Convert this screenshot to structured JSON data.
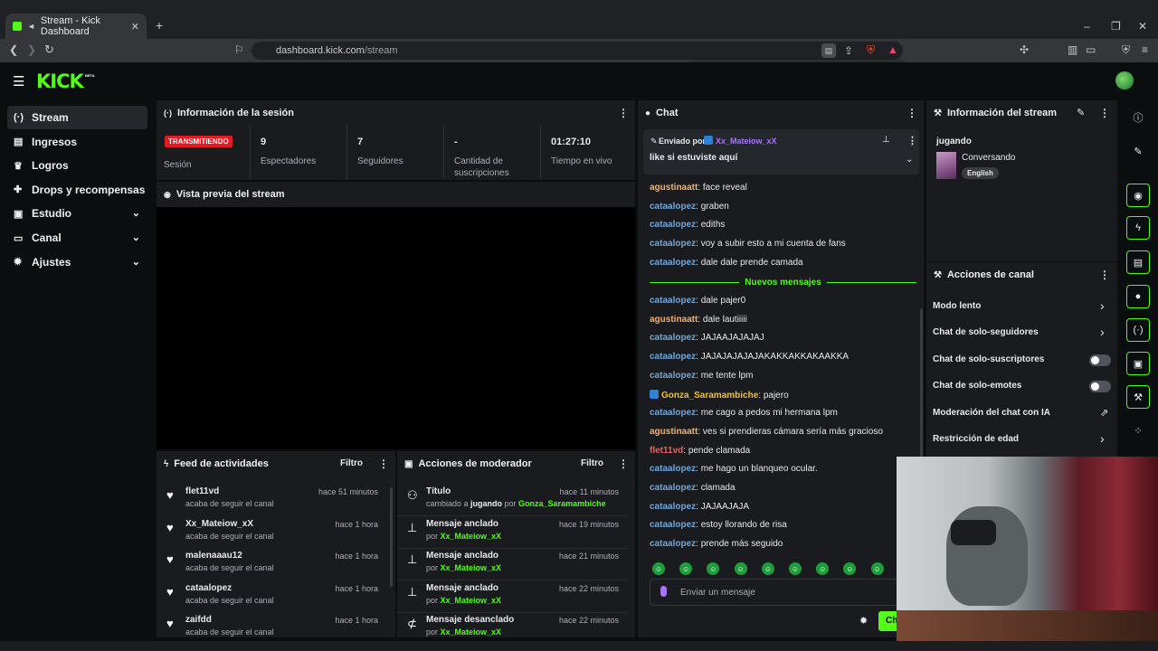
{
  "browser": {
    "tab_title": "Stream - Kick Dashboard",
    "url_host": "dashboard.kick.com",
    "url_path": "/stream",
    "new_tab_symbol": "+",
    "window_controls": [
      "–",
      "❐",
      "✕"
    ]
  },
  "brand": {
    "logo": "KICK",
    "beta": "BETA",
    "accent": "#53fc18"
  },
  "sidebar": {
    "items": [
      {
        "label": "Stream",
        "icon": "broadcast-icon",
        "glyph": "(·)",
        "active": true
      },
      {
        "label": "Ingresos",
        "icon": "wallet-icon",
        "glyph": "▤"
      },
      {
        "label": "Logros",
        "icon": "trophy-icon",
        "glyph": "♛"
      },
      {
        "label": "Drops y recompensas",
        "icon": "gift-icon",
        "glyph": "✚"
      },
      {
        "label": "Estudio",
        "icon": "studio-icon",
        "glyph": "▣",
        "expandable": true
      },
      {
        "label": "Canal",
        "icon": "channel-icon",
        "glyph": "▭",
        "expandable": true
      },
      {
        "label": "Ajustes",
        "icon": "gear-icon",
        "glyph": "✹",
        "expandable": true
      }
    ]
  },
  "session": {
    "title": "Información de la sesión",
    "badge": "TRANSMITIENDO",
    "badge_sub": "Sesión",
    "stats": [
      {
        "value": "9",
        "label": "Espectadores"
      },
      {
        "value": "7",
        "label": "Seguidores"
      },
      {
        "value": "-",
        "label": "Cantidad de suscripciones"
      },
      {
        "value": "01:27:10",
        "label": "Tiempo en vivo"
      }
    ]
  },
  "preview": {
    "title": "Vista previa del stream"
  },
  "feed": {
    "title": "Feed de actividades",
    "filter": "Filtro",
    "items": [
      {
        "name": "flet11vd",
        "action": "acaba de seguir el canal",
        "time": "hace 51 minutos"
      },
      {
        "name": "Xx_Mateiow_xX",
        "action": "acaba de seguir el canal",
        "time": "hace 1 hora"
      },
      {
        "name": "malenaaau12",
        "action": "acaba de seguir el canal",
        "time": "hace 1 hora"
      },
      {
        "name": "cataalopez",
        "action": "acaba de seguir el canal",
        "time": "hace 1 hora"
      },
      {
        "name": "zaifdd",
        "action": "acaba de seguir el canal",
        "time": "hace 1 hora"
      }
    ]
  },
  "mod": {
    "title": "Acciones de moderador",
    "filter": "Filtro",
    "items": [
      {
        "title": "Título",
        "line_pre": "cambiado a ",
        "line_bold": "jugando",
        "line_mid": " por ",
        "line_user": "Gonza_Saramambiche",
        "time": "hace 11 minutos",
        "icon": "title-icon"
      },
      {
        "title": "Mensaje anclado",
        "line_pre": "",
        "line_bold": "",
        "line_mid": "por ",
        "line_user": "Xx_Mateiow_xX",
        "time": "hace 19 minutos",
        "icon": "pin-icon"
      },
      {
        "title": "Mensaje anclado",
        "line_pre": "",
        "line_bold": "",
        "line_mid": "por ",
        "line_user": "Xx_Mateiow_xX",
        "time": "hace 21 minutos",
        "icon": "pin-icon"
      },
      {
        "title": "Mensaje anclado",
        "line_pre": "",
        "line_bold": "",
        "line_mid": "por ",
        "line_user": "Xx_Mateiow_xX",
        "time": "hace 22 minutos",
        "icon": "pin-icon"
      },
      {
        "title": "Mensaje desanclado",
        "line_pre": "",
        "line_bold": "",
        "line_mid": "por ",
        "line_user": "Xx_Mateiow_xX",
        "time": "hace 22 minutos",
        "icon": "unpin-icon"
      }
    ]
  },
  "chat": {
    "title": "Chat",
    "pinned_by_label": "Enviado por",
    "pinned_user": "Xx_Mateiow_xX",
    "pinned_text": "like si estuviste aquí",
    "new_messages": "Nuevos mensajes",
    "input_placeholder": "Enviar un mensaje",
    "send_label": "Ch",
    "messages_before": [
      {
        "user": "agustinaatt",
        "color": "#f6b26b",
        "text": "face reveal"
      },
      {
        "user": "cataalopez",
        "color": "#6fa8dc",
        "text": "graben"
      },
      {
        "user": "cataalopez",
        "color": "#6fa8dc",
        "text": "ediths"
      },
      {
        "user": "cataalopez",
        "color": "#6fa8dc",
        "text": "voy a subir esto a mi cuenta de fans"
      },
      {
        "user": "cataalopez",
        "color": "#6fa8dc",
        "text": "dale dale prende camada"
      }
    ],
    "messages_after": [
      {
        "user": "cataalopez",
        "color": "#6fa8dc",
        "text": "dale pajer0"
      },
      {
        "user": "agustinaatt",
        "color": "#f6b26b",
        "text": "dale lautiiiii"
      },
      {
        "user": "cataalopez",
        "color": "#6fa8dc",
        "text": "JAJAAJAJAJAJ"
      },
      {
        "user": "cataalopez",
        "color": "#6fa8dc",
        "text": "JAJAJAJAJAJAKAKKAKKAKAAKKA"
      },
      {
        "user": "cataalopez",
        "color": "#6fa8dc",
        "text": "me tente lpm"
      },
      {
        "user": "Gonza_Saramambiche",
        "color": "#f1c232",
        "text": "pajero"
      },
      {
        "user": "cataalopez",
        "color": "#6fa8dc",
        "text": "me cago a pedos mi hermana lpm"
      },
      {
        "user": "agustinaatt",
        "color": "#f6b26b",
        "text": "ves si prendieras cámara sería más gracioso"
      },
      {
        "user": "flet11vd",
        "color": "#e06666",
        "text": "pende clamada"
      },
      {
        "user": "cataalopez",
        "color": "#6fa8dc",
        "text": "me hago un blanqueo ocular."
      },
      {
        "user": "cataalopez",
        "color": "#6fa8dc",
        "text": "clamada"
      },
      {
        "user": "cataalopez",
        "color": "#6fa8dc",
        "text": "JAJAAJAJA"
      },
      {
        "user": "cataalopez",
        "color": "#6fa8dc",
        "text": "estoy llorando de risa"
      },
      {
        "user": "cataalopez",
        "color": "#6fa8dc",
        "text": "prende más seguido"
      }
    ]
  },
  "stream_info": {
    "title": "Información del stream",
    "stream_title": "jugando",
    "category": "Conversando",
    "language": "English"
  },
  "channel_actions": {
    "title": "Acciones de canal",
    "items": [
      {
        "label": "Modo lento",
        "control": "chevron"
      },
      {
        "label": "Chat de solo-seguidores",
        "control": "chevron"
      },
      {
        "label": "Chat de solo-suscriptores",
        "control": "toggle"
      },
      {
        "label": "Chat de solo-emotes",
        "control": "toggle"
      },
      {
        "label": "Moderación del chat con IA",
        "control": "external"
      },
      {
        "label": "Restricción de edad",
        "control": "chevron"
      }
    ]
  }
}
